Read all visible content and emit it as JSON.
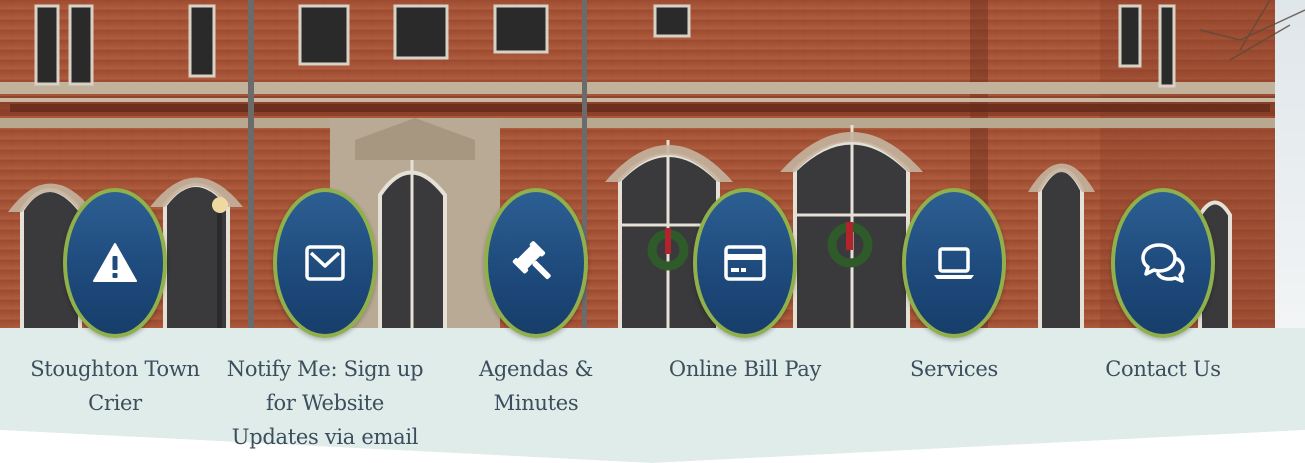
{
  "quicklinks": [
    {
      "label": "Stoughton Town Crier",
      "icon": "warning-icon"
    },
    {
      "label": "Notify Me: Sign up for Website Updates via email",
      "icon": "envelope-icon"
    },
    {
      "label": "Agendas & Minutes",
      "icon": "gavel-icon"
    },
    {
      "label": "Online Bill Pay",
      "icon": "credit-card-icon"
    },
    {
      "label": "Services",
      "icon": "laptop-icon"
    },
    {
      "label": "Contact Us",
      "icon": "chat-bubbles-icon"
    }
  ],
  "colors": {
    "circle_fill": "#1e4a7c",
    "circle_border": "#8fb04a",
    "strip_background": "#e0ecea",
    "label_text": "#3a4e5c",
    "brick": "#a8553a",
    "stone": "#bfae98"
  }
}
